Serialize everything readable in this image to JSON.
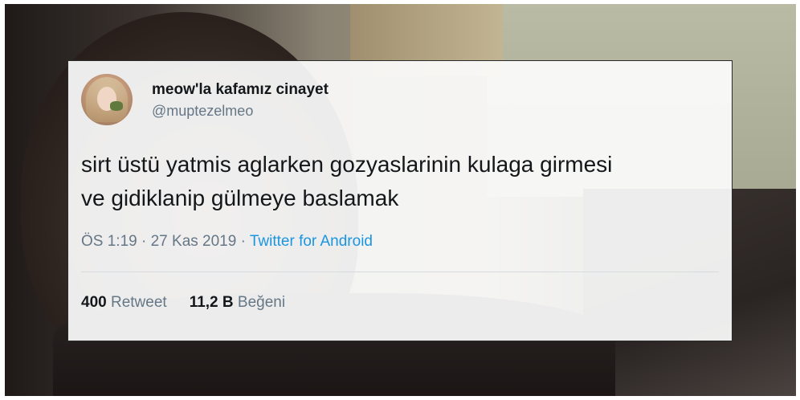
{
  "tweet": {
    "display_name": "meow'la kafamız cinayet",
    "handle": "@muptezelmeo",
    "text_line1": "sirt üstü yatmis aglarken gozyaslarinin kulaga girmesi",
    "text_line2": "ve gidiklanip gülmeye baslamak",
    "time": "ÖS 1:19",
    "sep1": " · ",
    "date": "27 Kas 2019",
    "sep2": " · ",
    "source": "Twitter for Android",
    "retweet_count": "400",
    "retweet_label": "Retweet",
    "like_count": "11,2 B",
    "like_label": "Beğeni"
  },
  "colors": {
    "link": "#1b95e0",
    "secondary_text": "#657786",
    "primary_text": "#14171a"
  },
  "icons": {
    "avatar": "profile-photo"
  }
}
